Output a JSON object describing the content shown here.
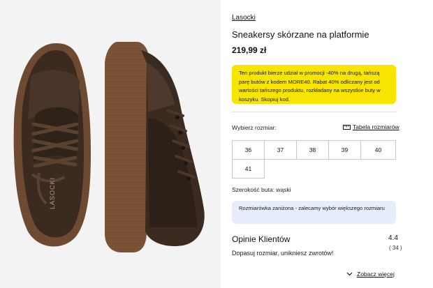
{
  "product": {
    "brand": "Lasocki",
    "title": "Sneakersy skórzane na platformie",
    "price": "219,99 zł",
    "image_alt": "Brązowe sneakersy Lasocki",
    "image_logo_text": "LASOCKI"
  },
  "promo": {
    "text": "Ten produkt bierze udział w promocji -40% na drugą, tańszą parę butów z kodem MORE40. Rabat 40% odliczany jest od wartości tańszego produktu, rozkładany na wszystkie buty w koszyku. Skopiuj kod."
  },
  "sizes": {
    "label": "Wybierz rozmiar:",
    "chart_label": "Tabela rozmiarów",
    "options": [
      "36",
      "37",
      "38",
      "39",
      "40",
      "41"
    ]
  },
  "fit": {
    "width_text": "Szerokość buta: wąski",
    "notice": "Rozmiarówka zaniżona - zalecamy wybór większego rozmiaru"
  },
  "reviews": {
    "title": "Opinie Klientów",
    "rating": "4.4",
    "count": "( 34 )",
    "subtitle": "Dopasuj rozmiar, unikniesz zwrotów!",
    "see_more": "Zobacz więcej"
  },
  "colors": {
    "promo_bg": "#f7e500",
    "notice_bg": "#e6eefb",
    "shoe_leather": "#3a2a20",
    "shoe_sole": "#7a5236"
  },
  "icons": [
    "ruler-icon",
    "chevron-down-icon"
  ]
}
